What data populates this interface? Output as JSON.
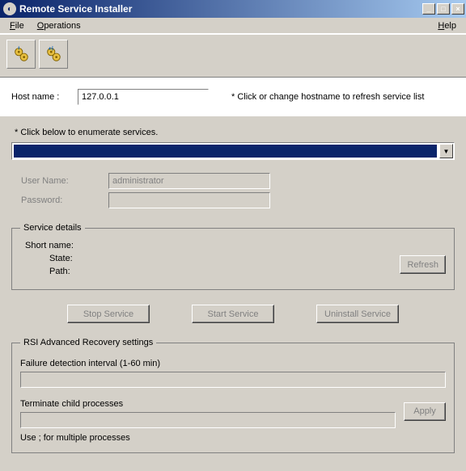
{
  "window": {
    "title": "Remote Service Installer"
  },
  "menu": {
    "file": "File",
    "operations": "Operations",
    "help": "Help"
  },
  "host": {
    "label": "Host name :",
    "value": "127.0.0.1",
    "note": "* Click or change hostname to refresh service list"
  },
  "enum_note": "* Click below to enumerate services.",
  "combo_value": "",
  "cred": {
    "user_label": "User Name:",
    "user_value": "administrator",
    "pass_label": "Password:",
    "pass_value": ""
  },
  "svc": {
    "legend": "Service details",
    "short_label": "Short name:",
    "short_value": "",
    "state_label": "State:",
    "state_value": "",
    "path_label": "Path:",
    "path_value": "",
    "refresh": "Refresh"
  },
  "buttons": {
    "stop": "Stop Service",
    "start": "Start Service",
    "uninstall": "Uninstall Service"
  },
  "adv": {
    "legend": "RSI Advanced Recovery settings",
    "interval_label": "Failure detection interval (1-60 min)",
    "interval_value": "",
    "term_label": "Terminate child processes",
    "term_value": "",
    "apply": "Apply",
    "note": "Use ; for multiple processes"
  }
}
